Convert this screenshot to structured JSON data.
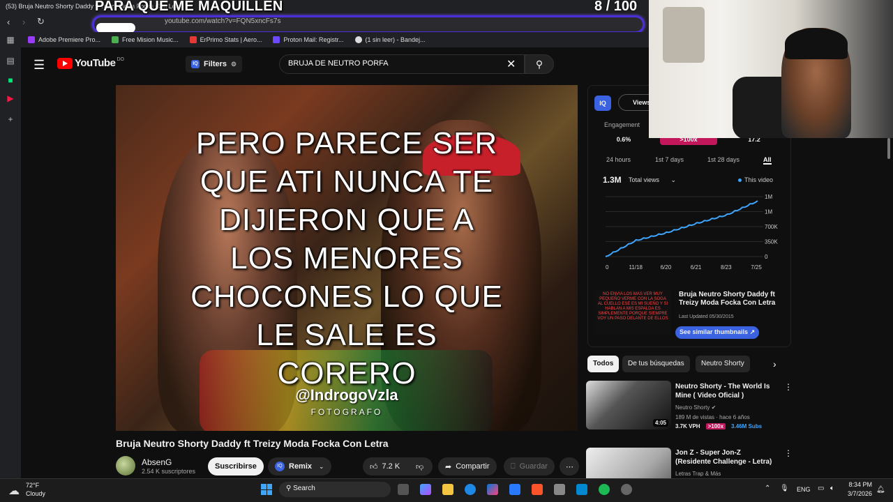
{
  "browser": {
    "tab_title": "(53) Bruja Neutro Shorty Daddy ft Treizy Moda Focka Con Letra",
    "url": "youtube.com/watch?v=FQN5xncFs7s",
    "bookmarks": [
      {
        "label": "Adobe Premiere Pro..."
      },
      {
        "label": "Free Mision Music..."
      },
      {
        "label": "ErPrimo Stats | Aero..."
      },
      {
        "label": "Proton Mail: Registr..."
      },
      {
        "label": "(1 sin leer) - Bandej..."
      }
    ]
  },
  "stream_overlay": {
    "caption": "PARA QUE ME MAQUILLEN",
    "counter": "8  / 100"
  },
  "youtube": {
    "logo_text": "YouTube",
    "region": "DO",
    "filters_label": "Filters",
    "search_query": "BRUJA DE NEUTRO PORFA"
  },
  "video": {
    "lyrics_lines": [
      "PERO PARECE SER",
      "QUE ATI NUNCA TE",
      "DIJIERON QUE A",
      "LOS MENORES",
      "CHOCONES LO QUE",
      "LE SALE ES",
      "CORERO"
    ],
    "watermark": "@IndrogoVzla",
    "watermark_sub": "FOTOGRAFO",
    "title": "Bruja Neutro Shorty Daddy ft Treizy Moda Focka Con Letra",
    "channel": "AbsenG",
    "subscribers": "2.54 K suscriptores",
    "subscribe_label": "Suscribirse",
    "remix_label": "Remix",
    "likes": "7.2 K",
    "share_label": "Compartir",
    "save_label": "Guardar"
  },
  "vidiq": {
    "logo": "IQ",
    "views_tab": "Views",
    "engagement_label": "Engagement",
    "metrics": [
      "0.6%",
      ">100x",
      "17.2"
    ],
    "periods": [
      "24 hours",
      "1st 7 days",
      "1st 28 days",
      "All"
    ],
    "total": "1.3M",
    "total_label": "Total views",
    "legend": "This video",
    "similar": {
      "title": "Bruja Neutro Shorty Daddy ft Treizy Moda Focka Con Letra",
      "updated": "Last Updated 05/30/2015",
      "button": "See similar thumbnails",
      "thumb_text": "NO ENVIA LOS MAS VER MUY PEQUEÑO VERME CON LA SOGA AL CUELLO ESE ES MI SUEÑO Y SI HABLAN A MIS ESPALDA ES SIMPLEMENTE PORQUE SIEMPRE VOY UN PASO DELANTE DE ELLOS"
    }
  },
  "chart_data": {
    "type": "line",
    "x": [
      "11/18",
      "6/20",
      "6/21",
      "8/23",
      "7/25"
    ],
    "x_start_label": "0",
    "y_ticks": [
      "0",
      "350K",
      "700K",
      "1M",
      "1M"
    ],
    "series": [
      {
        "name": "This video",
        "values": [
          0,
          380000,
          560000,
          780000,
          980000,
          1300000
        ]
      }
    ],
    "ylim": [
      0,
      1400000
    ],
    "color": "#3ea6ff"
  },
  "chips": [
    "Todos",
    "De tus búsquedas",
    "Neutro Shorty"
  ],
  "recommendations": [
    {
      "title": "Neutro Shorty - The World Is Mine ( Video Oficial )",
      "channel": "Neutro Shorty",
      "stats": "189 M de vistas · hace 6 años",
      "duration": "4:05",
      "vph": "3.7K VPH",
      "multiplier": ">100x",
      "subs": "3.46M Subs"
    },
    {
      "title": "Jon Z - Super Jon-Z (Residente Challenge - Letra)",
      "channel": "Letras Trap & Más"
    }
  ],
  "taskbar": {
    "temp": "72°F",
    "weather": "Cloudy",
    "search": "Search",
    "lang": "ENG",
    "time": "8:34 PM",
    "date": "3/7/2026"
  }
}
